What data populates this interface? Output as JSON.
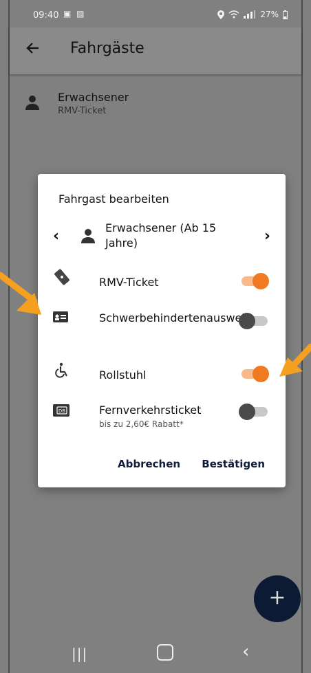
{
  "status_bar": {
    "time": "09:40",
    "battery": "27%"
  },
  "app_bar": {
    "title": "Fahrgäste",
    "back_icon": "arrow-left-icon"
  },
  "passenger": {
    "title": "Erwachsener",
    "subtitle": "RMV-Ticket"
  },
  "dialog": {
    "title": "Fahrgast bearbeiten",
    "selected_type": "Erwachsener (Ab 15 Jahre)",
    "options": [
      {
        "label": "RMV-Ticket",
        "icon": "ticket-icon",
        "enabled": true
      },
      {
        "label": "Schwerbehindertenausweis",
        "icon": "id-card-icon",
        "enabled": false
      },
      {
        "label": "Rollstuhl",
        "icon": "wheelchair-icon",
        "enabled": true
      },
      {
        "label": "Fernverkehrsticket",
        "sublabel": "bis zu 2,60€ Rabatt*",
        "icon": "db-icon",
        "enabled": false
      }
    ],
    "cancel_label": "Abbrechen",
    "confirm_label": "Bestätigen"
  },
  "fab_label": "+",
  "colors": {
    "accent": "#f07a22",
    "primary_dark": "#0c1a33",
    "arrow_annotation": "#f5a020"
  }
}
